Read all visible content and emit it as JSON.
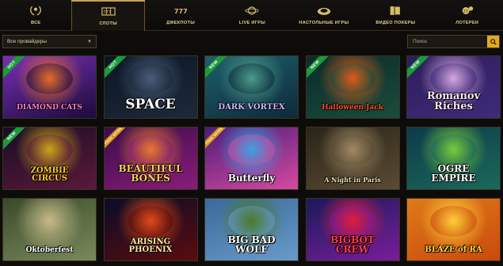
{
  "nav": {
    "tabs": [
      {
        "label": "ВСЕ",
        "icon": "laurel-icon",
        "active": false
      },
      {
        "label": "СЛОТЫ",
        "icon": "slot-reels-icon",
        "active": true
      },
      {
        "label": "ДЖЕКПОТЫ",
        "icon": "jackpot-777-icon",
        "active": false
      },
      {
        "label": "LIVE ИГРЫ",
        "icon": "live-globe-icon",
        "active": false
      },
      {
        "label": "НАСТОЛЬНЫЕ ИГРЫ",
        "icon": "roulette-icon",
        "active": false
      },
      {
        "label": "ВИДЕО ПОКЕРЫ",
        "icon": "cards-icon",
        "active": false
      },
      {
        "label": "ЛОТЕРЕИ",
        "icon": "lottery-balls-icon",
        "active": false
      }
    ]
  },
  "filter": {
    "provider_label": "Все провайдеры",
    "search_placeholder": "Поиск"
  },
  "games": [
    {
      "title": "DIAMOND CATS",
      "badge": "HOT",
      "badge_color": "#1d9a3b",
      "colors": [
        "#7a2fb8",
        "#1a0c3a",
        "#e36b2a"
      ],
      "title_color": "#ff7ad9",
      "size": 9
    },
    {
      "title": "SPACE",
      "badge": "HOT",
      "badge_color": "#1d9a3b",
      "colors": [
        "#0a1524",
        "#1d2a3a",
        "#4a5d7a"
      ],
      "title_color": "#ffffff",
      "size": 17
    },
    {
      "title": "DARK VORTEX",
      "badge": "NEW",
      "badge_color": "#1d9a3b",
      "colors": [
        "#1e5f6b",
        "#0d2a3a",
        "#4b9b8a"
      ],
      "title_color": "#c9b8ff",
      "size": 10
    },
    {
      "title": "Halloween Jack",
      "badge": "NEW",
      "badge_color": "#1d9a3b",
      "colors": [
        "#0a2a2a",
        "#1a4d3c",
        "#d95b1a"
      ],
      "title_color": "#ff4a2a",
      "size": 9
    },
    {
      "title": "Romanov\nRiches",
      "badge": "NEW",
      "badge_color": "#1d9a3b",
      "colors": [
        "#2d1d5a",
        "#3e2b7a",
        "#d6a6e0"
      ],
      "title_color": "#f5e6ff",
      "size": 13
    },
    {
      "title": "ZOMBIE\nCIRCUS",
      "badge": "NEW",
      "badge_color": "#1d9a3b",
      "colors": [
        "#1a0c24",
        "#5a1a3a",
        "#c9a31a"
      ],
      "title_color": "#ffcc2a",
      "size": 10
    },
    {
      "title": "BEAUTIFUL\nBONES",
      "badge": "FREE SPINS",
      "badge_color": "#d59114",
      "colors": [
        "#3a0c4a",
        "#8a1d7a",
        "#e67a2a"
      ],
      "title_color": "#ffcf5a",
      "size": 12
    },
    {
      "title": "Butterfly",
      "badge": "FREE SPINS",
      "badge_color": "#d59114",
      "colors": [
        "#4a1d7a",
        "#d64aa0",
        "#3aa0e0"
      ],
      "title_color": "#ffffff",
      "size": 12
    },
    {
      "title": "A Night in Paris",
      "badge": "",
      "badge_color": "",
      "colors": [
        "#2a2418",
        "#5a4c34",
        "#a08a64"
      ],
      "title_color": "#f0e0b8",
      "size": 8
    },
    {
      "title": "OGRE\nEMPIRE",
      "badge": "",
      "badge_color": "",
      "colors": [
        "#0d3a4a",
        "#1a6a5a",
        "#7acb3a"
      ],
      "title_color": "#ffffff",
      "size": 12
    },
    {
      "title": "Oktoberfest",
      "badge": "",
      "badge_color": "",
      "colors": [
        "#3a4a2a",
        "#7a8a5a",
        "#c9b88a"
      ],
      "title_color": "#ffffff",
      "size": 9
    },
    {
      "title": "ARISING\nPHOENIX",
      "badge": "",
      "badge_color": "",
      "colors": [
        "#0a0c2a",
        "#5a0c0c",
        "#e04a1a"
      ],
      "title_color": "#ffe7a0",
      "size": 10
    },
    {
      "title": "BIG BAD\nWOLF",
      "badge": "",
      "badge_color": "",
      "colors": [
        "#3a6a9a",
        "#6a9ac9",
        "#4a7a2a"
      ],
      "title_color": "#ffffff",
      "size": 12
    },
    {
      "title": "BIGBOT\nCREW",
      "badge": "",
      "badge_color": "",
      "colors": [
        "#1a1a5a",
        "#7a1d9a",
        "#e01d3a"
      ],
      "title_color": "#ff3a4a",
      "size": 12
    },
    {
      "title": "BLAZE of RA",
      "badge": "",
      "badge_color": "",
      "colors": [
        "#e07a1a",
        "#c94a0c",
        "#ffcf3a"
      ],
      "title_color": "#ffd83a",
      "size": 10
    }
  ],
  "colors": {
    "accent": "#c8a24a",
    "search_button": "#e0a922",
    "background": "#0d0c0a"
  }
}
